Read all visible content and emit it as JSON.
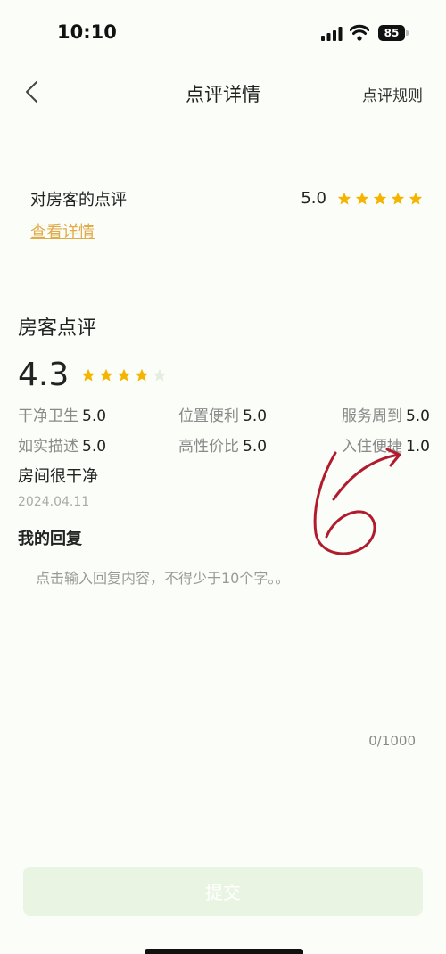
{
  "status_bar": {
    "time": "10:10",
    "battery": "85"
  },
  "nav": {
    "title": "点评详情",
    "rules_label": "点评规则"
  },
  "guest_review": {
    "label": "对房客的点评",
    "score": "5.0",
    "stars": 5,
    "link": "查看详情"
  },
  "host_review": {
    "title": "房客点评",
    "overall_score": "4.3",
    "overall_stars": 4,
    "subscores": [
      {
        "label": "干净卫生",
        "value": "5.0"
      },
      {
        "label": "位置便利",
        "value": "5.0"
      },
      {
        "label": "服务周到",
        "value": "5.0"
      },
      {
        "label": "如实描述",
        "value": "5.0"
      },
      {
        "label": "高性价比",
        "value": "5.0"
      },
      {
        "label": "入住便捷",
        "value": "1.0"
      }
    ],
    "comment": "房间很干净",
    "date": "2024.04.11"
  },
  "reply": {
    "title": "我的回复",
    "placeholder": "点击输入回复内容，不得少于10个字。。",
    "count": "0/1000"
  },
  "submit_label": "提交",
  "colors": {
    "star": "#f5b400",
    "link": "#e0ac48",
    "submit_bg": "#e9f5e2",
    "annotation": "#b01c2e"
  }
}
